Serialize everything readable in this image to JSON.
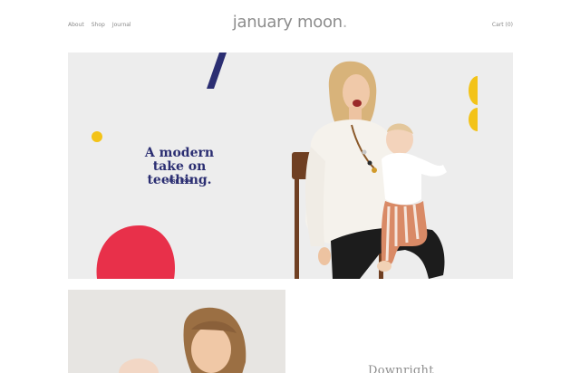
{
  "nav": {
    "items": [
      "About",
      "Shop",
      "Journal"
    ]
  },
  "brand": {
    "name": "january moon",
    "dot": "."
  },
  "cart": {
    "label": "Cart (0)"
  },
  "hero": {
    "title_line1": "A modern",
    "title_line2": "take on teething.",
    "cta": "Shop Now",
    "colors": {
      "background": "#ededed",
      "navy": "#2b2e72",
      "yellow": "#f3c318",
      "red": "#e8304a"
    }
  },
  "secondary": {
    "text": "Downright"
  }
}
